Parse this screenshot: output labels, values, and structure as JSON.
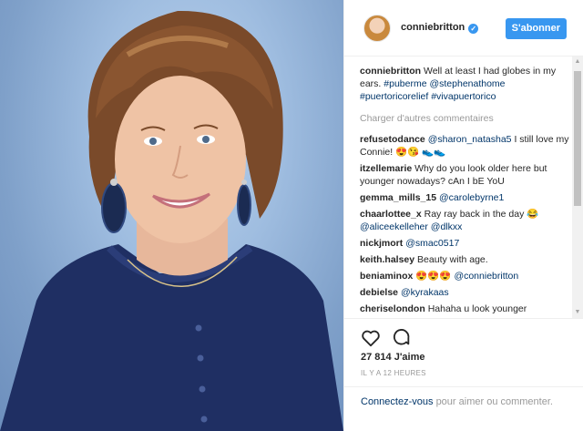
{
  "post": {
    "username": "conniebritton",
    "follow_label": "S'abonner",
    "caption": {
      "user": "conniebritton",
      "text": "Well at least I had globes in my ears.",
      "tags": [
        "#puberme",
        "@stephenathome",
        "#puertoricorelief",
        "#vivapuertorico"
      ]
    },
    "load_more": "Charger d'autres commentaires",
    "comments": [
      {
        "user": "refusetodance",
        "mention": "@sharon_natasha5",
        "text": "I still love my Connie! 😍😘 👟👟"
      },
      {
        "user": "itzellemarie",
        "mention": "",
        "text": "Why do you look older here but younger nowadays? cAn I bE YoU"
      },
      {
        "user": "gemma_mills_15",
        "mention": "@carolebyrne1",
        "text": ""
      },
      {
        "user": "chaarlottee_x",
        "mention": "",
        "text": "Ray ray back in the day 😂",
        "mention2": "@aliceekelleher",
        "mention3": "@dlkxx"
      },
      {
        "user": "nickjmort",
        "mention": "@smac0517",
        "text": ""
      },
      {
        "user": "keith.halsey",
        "mention": "",
        "text": "Beauty with age."
      },
      {
        "user": "beniaminox",
        "mention": "@conniebritton",
        "text": "😍😍😍"
      },
      {
        "user": "debielse",
        "mention": "@kyrakaas",
        "text": ""
      },
      {
        "user": "cheriselondon",
        "mention": "",
        "text": "Hahaha u look younger"
      }
    ],
    "likes": "27 814 J'aime",
    "time": "IL Y A 12 HEURES",
    "footer": {
      "login_link": "Connectez-vous",
      "login_text": "pour aimer ou commenter."
    }
  },
  "colors": {
    "accent": "#3897f0",
    "link": "#003569",
    "muted": "#999999"
  }
}
